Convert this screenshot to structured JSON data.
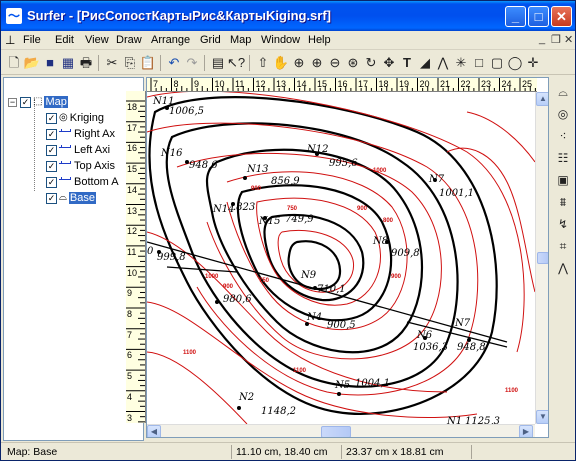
{
  "window": {
    "title": "Surfer - [РисСопостКартыРис&КартыKiging.srf]",
    "app_icon": "surfer-app-icon"
  },
  "menu": {
    "items": [
      "File",
      "Edit",
      "View",
      "Draw",
      "Arrange",
      "Grid",
      "Map",
      "Window",
      "Help"
    ]
  },
  "tree": {
    "root": "Map",
    "children": [
      "Kriging",
      "Right Ax",
      "Left Axi",
      "Top Axis",
      "Bottom A",
      "Base"
    ],
    "selected": "Base"
  },
  "rulers": {
    "horizontal": [
      "7",
      "8",
      "9",
      "10",
      "11",
      "12",
      "13",
      "14",
      "15",
      "16",
      "17",
      "18",
      "19",
      "20",
      "21",
      "22",
      "23",
      "24",
      "25",
      "2"
    ],
    "vertical": [
      "18",
      "17",
      "16",
      "15",
      "14",
      "13",
      "12",
      "11",
      "10",
      "9",
      "8",
      "7",
      "6",
      "5",
      "4",
      "3"
    ]
  },
  "map_labels": {
    "n11": "N11",
    "v1006_5": "1006,5",
    "n12": "N12",
    "v995": "995,6",
    "n16": "N16",
    "v948_6": "948,6",
    "n13": "N13",
    "v856": "856,9",
    "n7": "N7",
    "v1001": "1001,1",
    "n14": "N14",
    "v823": ".823",
    "n15": "N15",
    "v749": "749,9",
    "n8": "N8",
    "v909": "909,8",
    "zero": "0",
    "v999_8": "999,8",
    "n9": "N9",
    "v710": "710,1",
    "v980": "980,6",
    "n4": "N4",
    "v900": "900,5",
    "n6": "N6",
    "v1036": "1036,3",
    "n71": "N7",
    "v948_8": "948,8",
    "n5": "N5",
    "v1004": "1004,1",
    "n2": "N2",
    "v1148": "1148,2",
    "n1": "N1",
    "v1125": "1125,3"
  },
  "status": {
    "selection": "Map: Base",
    "cursor": "11.10 cm, 18.40 cm",
    "size": "23.37 cm x 18.81 cm"
  },
  "colors": {
    "titlebar": "#0053EE",
    "contour_red": "#D01010",
    "contour_black": "#000000",
    "selection": "#316AC5"
  }
}
